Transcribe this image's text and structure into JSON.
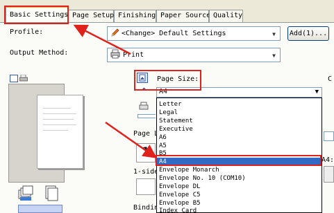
{
  "tabs": [
    {
      "label": "Basic Settings",
      "active": true
    },
    {
      "label": "Page Setup",
      "active": false
    },
    {
      "label": "Finishing",
      "active": false
    },
    {
      "label": "Paper Source",
      "active": false
    },
    {
      "label": "Quality",
      "active": false
    }
  ],
  "profile": {
    "label": "Profile:",
    "value": "<Change> Default Settings",
    "add_button": "Add(1)..."
  },
  "output_method": {
    "label": "Output Method:",
    "value": "Print"
  },
  "page_size": {
    "label": "Page Size:",
    "value": "A4",
    "right_value": "A4:",
    "options": [
      "Letter",
      "Legal",
      "Statement",
      "Executive",
      "A6",
      "A5",
      "B5",
      "A4",
      "Envelope Monarch",
      "Envelope No. 10 (COM10)",
      "Envelope DL",
      "Envelope C5",
      "Envelope B5",
      "Index Card"
    ],
    "selected_index": 7
  },
  "partial_labels": {
    "page_layout": "Page L",
    "one_sided": "1-side",
    "one_digit": "1",
    "binding": "Bindin",
    "right_letter": "C"
  },
  "colors": {
    "highlight": "#e0201b",
    "selection": "#316ac5",
    "tab_accent": "#e8a33d"
  }
}
